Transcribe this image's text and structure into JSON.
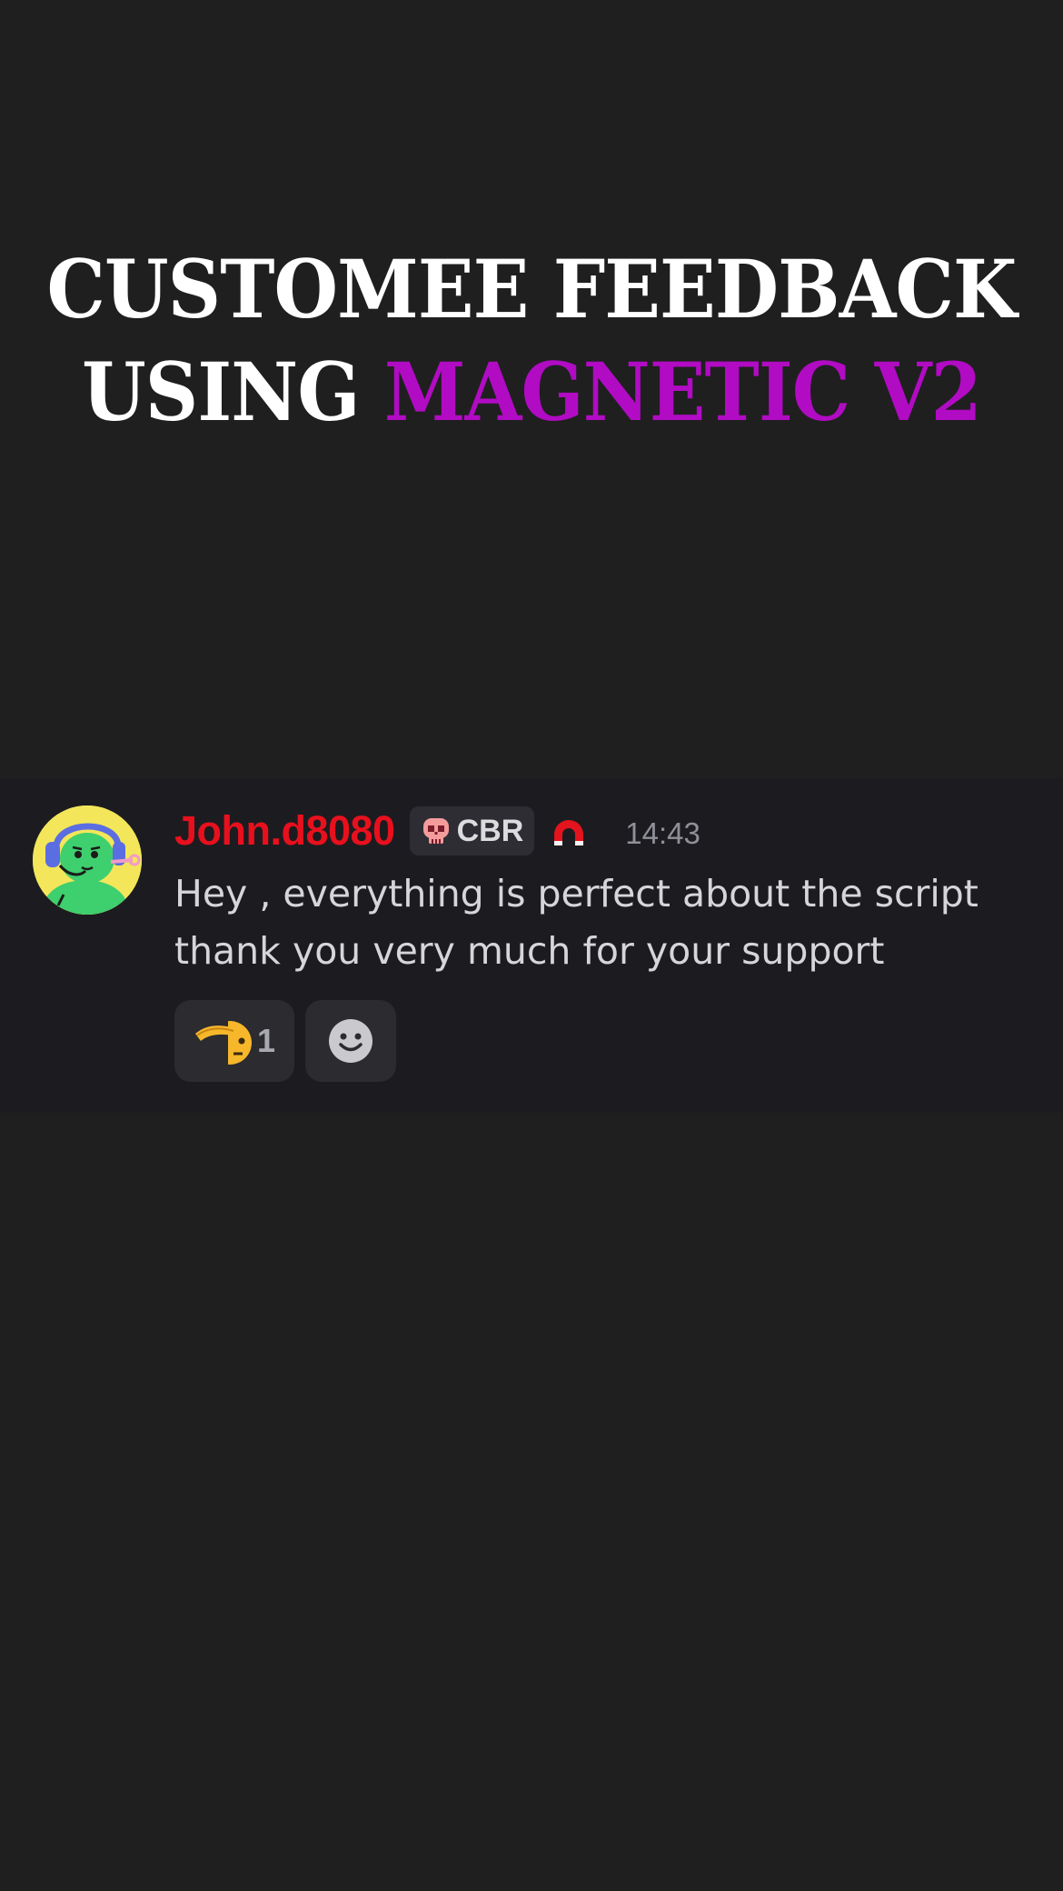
{
  "headline": {
    "line1": "CUSTOMEE FEEDBACK",
    "line2_prefix": "USING ",
    "line2_accent": "MAGNETIC V2",
    "accent_color": "#b10bc4"
  },
  "message": {
    "username": "John.d8080",
    "username_color": "#e8101d",
    "tag": {
      "icon": "skull-icon",
      "label": "CBR"
    },
    "badge_icon": "magnet-icon",
    "timestamp": "14:43",
    "text_lines": [
      "Hey , everything is perfect about the script",
      "thank you very much for your support"
    ],
    "reactions": [
      {
        "icon": "salute-emoji-icon",
        "count": "1"
      },
      {
        "icon": "add-reaction-smiley-icon",
        "count": ""
      }
    ]
  }
}
